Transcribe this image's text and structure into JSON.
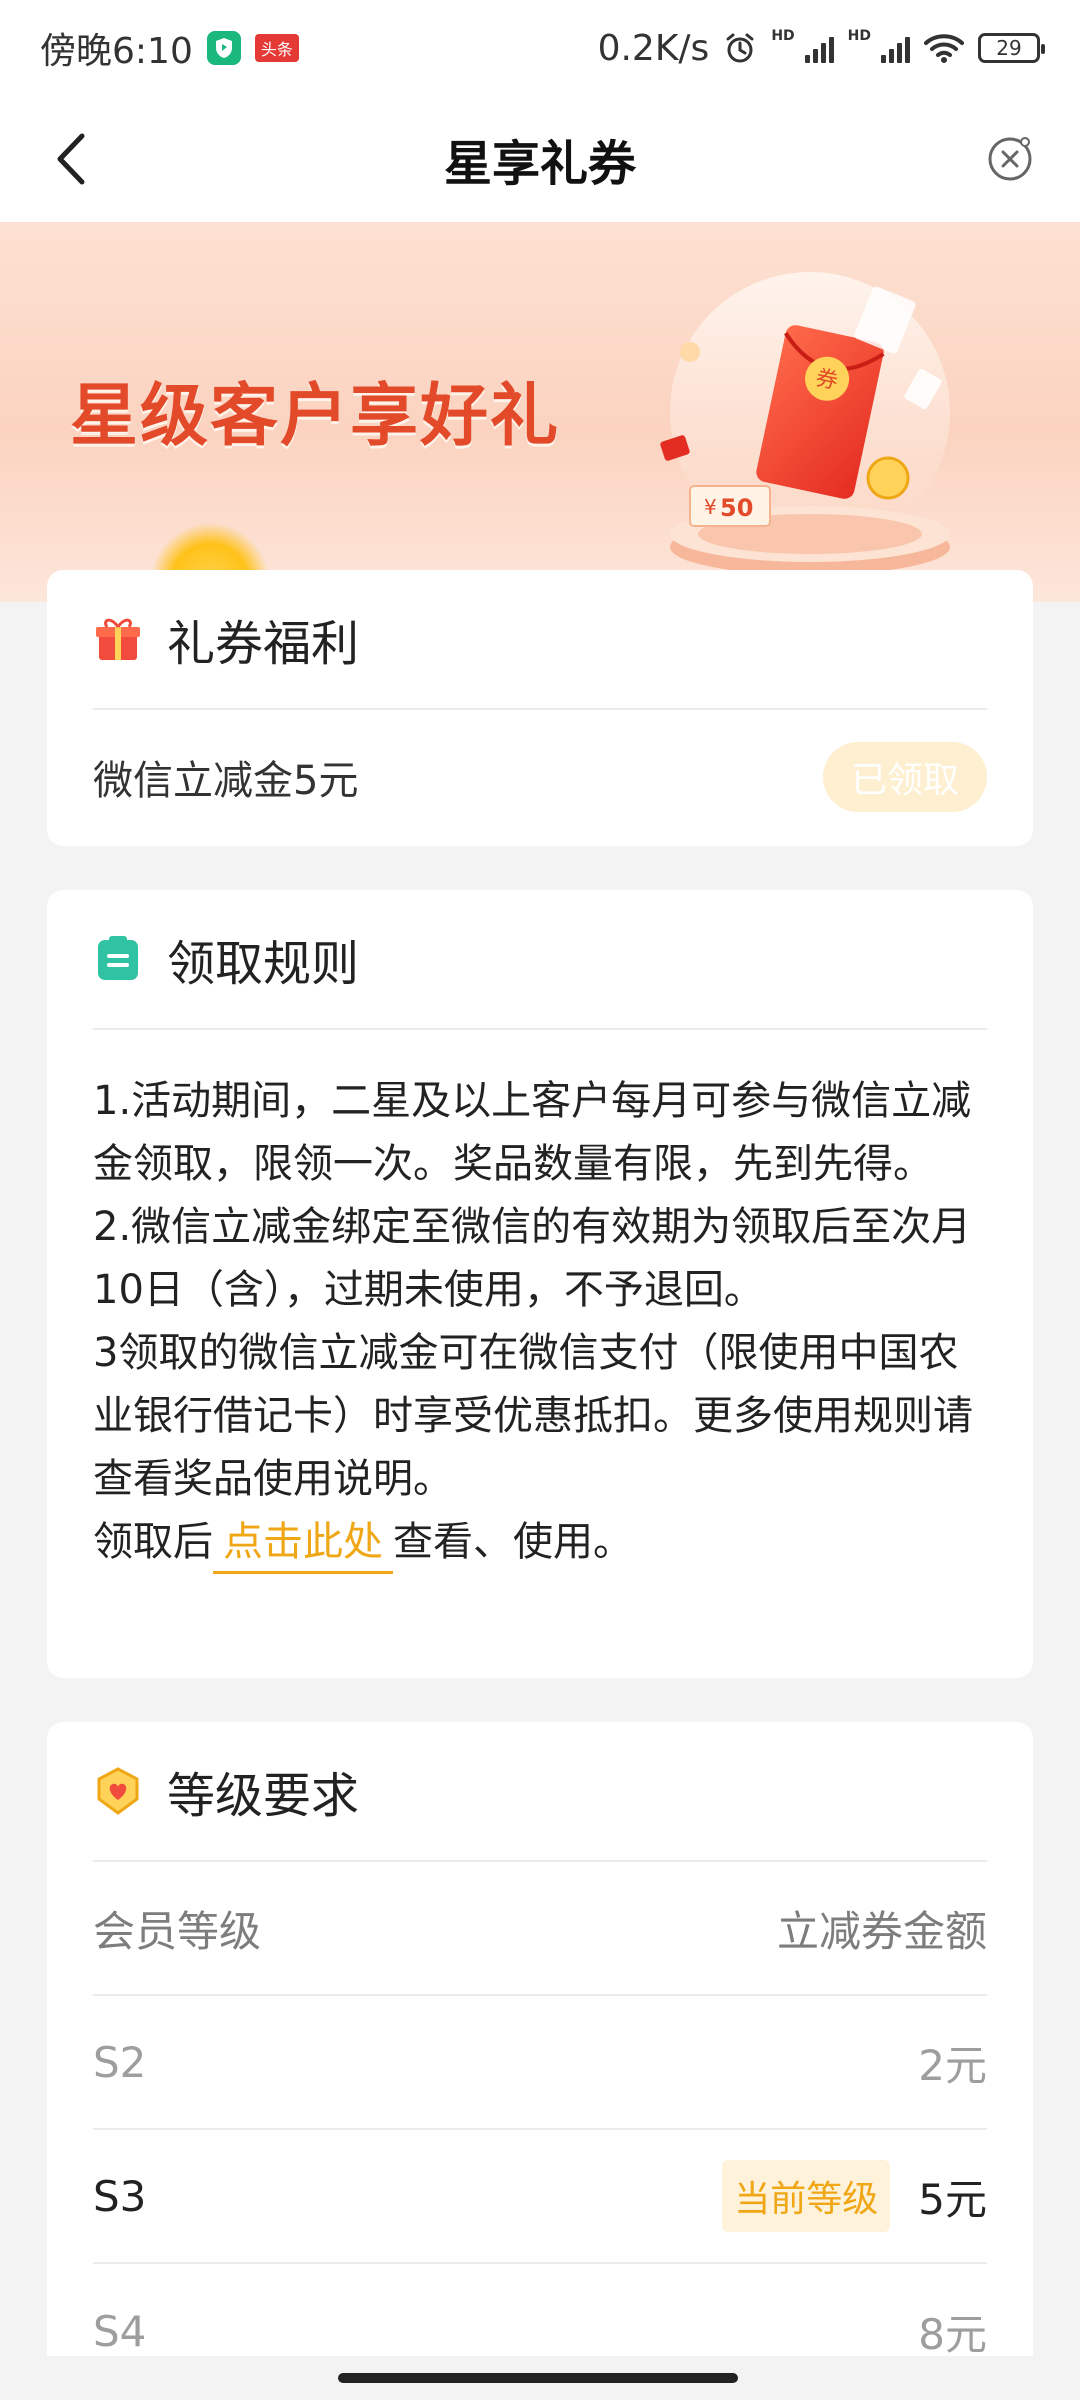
{
  "status_bar": {
    "time": "傍晚6:10",
    "news_badge": "头条",
    "net_speed": "0.2K/s",
    "hd_label": "HD",
    "battery": "29"
  },
  "nav": {
    "title": "星享礼券",
    "back_icon": "chevron-left-icon",
    "close_icon": "close-circle-icon"
  },
  "banner": {
    "headline": "星级客户享好礼",
    "coupon_value": "50",
    "coupon_symbol": "¥",
    "envelope_char": "券"
  },
  "benefit": {
    "title": "礼券福利",
    "item_name": "微信立减金5元",
    "status_button": "已领取"
  },
  "rules": {
    "title": "领取规则",
    "lines": [
      "1.活动期间，二星及以上客户每月可参与微信立减金领取，限领一次。奖品数量有限，先到先得。",
      "2.微信立减金绑定至微信的有效期为领取后至次月10日（含），过期未使用，不予退回。",
      "3领取的微信立减金可在微信支付（限使用中国农业银行借记卡）时享受优惠抵扣。更多使用规则请查看奖品使用说明。"
    ],
    "last_prefix": "领取后",
    "link_text": "点击此处",
    "last_suffix": "查看、使用。"
  },
  "level": {
    "title": "等级要求",
    "col_level": "会员等级",
    "col_amount": "立减券金额",
    "current_tag": "当前等级",
    "rows": [
      {
        "level": "S2",
        "amount": "2元"
      },
      {
        "level": "S3",
        "amount": "5元"
      },
      {
        "level": "S4",
        "amount": "8元"
      }
    ]
  },
  "colors": {
    "accent": "#f0a716",
    "banner_text": "#e24a2a",
    "gift_icon": "#f04b3c",
    "rules_icon": "#2fc3a4"
  }
}
